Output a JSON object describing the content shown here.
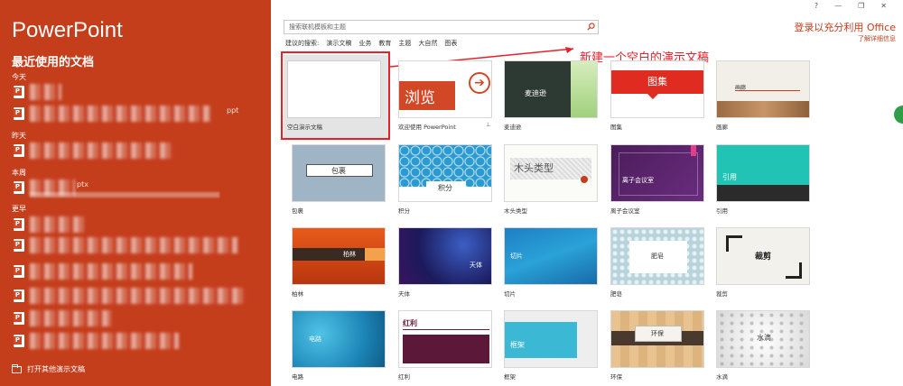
{
  "app": {
    "title": "PowerPoint"
  },
  "recent": {
    "title": "最近使用的文档",
    "groups": [
      {
        "label": "今天"
      },
      {
        "label": "昨天"
      },
      {
        "label": "本周"
      },
      {
        "label": "更早"
      }
    ],
    "fragments": {
      "today_ext": "ppt",
      "week_ext": "ptx"
    },
    "open_other": "打开其他演示文稿"
  },
  "search": {
    "placeholder": "搜索联机模板和主题",
    "suggest_label": "建议的搜索:",
    "suggestions": [
      "演示文稿",
      "业务",
      "教育",
      "主题",
      "大自然",
      "图表"
    ]
  },
  "window": {
    "help": "?",
    "minimize": "—",
    "restore": "❐",
    "close": "✕"
  },
  "account": {
    "signin": "登录以充分利用 Office",
    "learn_more": "了解详细信息"
  },
  "annotation": {
    "text": "新建一个空白的演示文稿"
  },
  "templates": [
    {
      "label": "空白演示文稿"
    },
    {
      "label": "欢迎使用 PowerPoint",
      "thumb_text": "浏览"
    },
    {
      "label": "麦迪逊",
      "thumb_text": "麦迪逊"
    },
    {
      "label": "图集",
      "thumb_text": "图集"
    },
    {
      "label": "画廊",
      "thumb_text": "画廊"
    },
    {
      "label": "包裹",
      "thumb_text": "包裹"
    },
    {
      "label": "积分",
      "thumb_text": "积分"
    },
    {
      "label": "木头类型",
      "thumb_text": "木头类型"
    },
    {
      "label": "离子会议室",
      "thumb_text": "离子会议室"
    },
    {
      "label": "引用",
      "thumb_text": "引用"
    },
    {
      "label": "柏林",
      "thumb_text": "柏林"
    },
    {
      "label": "天体",
      "thumb_text": "天体"
    },
    {
      "label": "切片",
      "thumb_text": "切片"
    },
    {
      "label": "肥皂",
      "thumb_text": "肥皂"
    },
    {
      "label": "裁剪",
      "thumb_text": "裁剪"
    },
    {
      "label": "电路",
      "thumb_text": "电路"
    },
    {
      "label": "红利",
      "thumb_text": "红利"
    },
    {
      "label": "框架",
      "thumb_text": "框架"
    },
    {
      "label": "环保",
      "thumb_text": "环保"
    },
    {
      "label": "水滴",
      "thumb_text": "水滴"
    }
  ],
  "colors": {
    "accent": "#c43e1c",
    "annotation": "#e8202a"
  }
}
